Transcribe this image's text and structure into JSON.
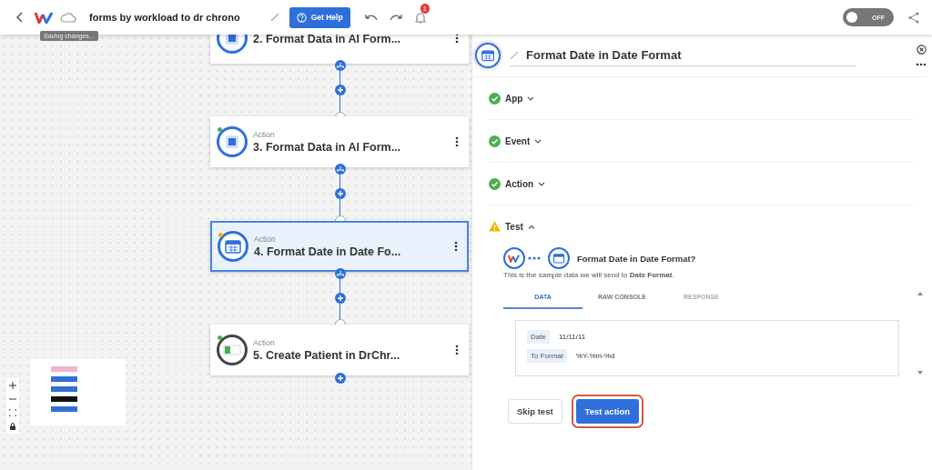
{
  "topbar": {
    "title": "forms by workload to dr chrono",
    "tooltip": "Saving changes...",
    "help_button": "Get Help",
    "notifications": "1",
    "toggle": {
      "on": false,
      "label": "OFF"
    }
  },
  "canvas": {
    "nodes": [
      {
        "title": "2. Format Data in AI Form...",
        "selected": false
      },
      {
        "label": "Action",
        "title": "3. Format Data in AI Form...",
        "color": "#4caf50",
        "selected": false
      },
      {
        "label": "Action",
        "title": "4. Format Date in Date Fo...",
        "color": "#f4b400",
        "selected": true
      },
      {
        "label": "Action",
        "title": "5. Create Patient in DrChr...",
        "color": "#4caf50",
        "selected": false
      }
    ],
    "minimap": [
      {
        "color": "#f0b4cc"
      },
      {
        "color": "#2f6fdc"
      },
      {
        "color": "#2f6fdc"
      },
      {
        "color": "#111111"
      },
      {
        "color": "#2f6fdc"
      }
    ]
  },
  "panel": {
    "title": "Format Date in Date Format",
    "sections": [
      {
        "label": "App",
        "complete": true,
        "expanded": false
      },
      {
        "label": "Event",
        "complete": true,
        "expanded": false
      },
      {
        "label": "Action",
        "complete": true,
        "expanded": false
      },
      {
        "label": "Test",
        "complete": false,
        "expanded": true
      }
    ],
    "test": {
      "question": "Format Date in Date Format?",
      "description": "This is the sample data we will send to **Date Format**.",
      "tabs": [
        {
          "label": "DATA",
          "selected": true,
          "disabled": false
        },
        {
          "label": "RAW CONSOLE",
          "selected": false,
          "disabled": false
        },
        {
          "label": "RESPONSE",
          "selected": false,
          "disabled": true
        }
      ],
      "fields": [
        {
          "key": "Date",
          "value": "11/11/11"
        },
        {
          "key": "To Format",
          "value": "%Y-%m-%d"
        }
      ],
      "buttons": [
        {
          "label": "Skip test",
          "kind": "secondary",
          "highlighted": false
        },
        {
          "label": "Test action",
          "kind": "primary",
          "highlighted": true
        }
      ]
    }
  }
}
